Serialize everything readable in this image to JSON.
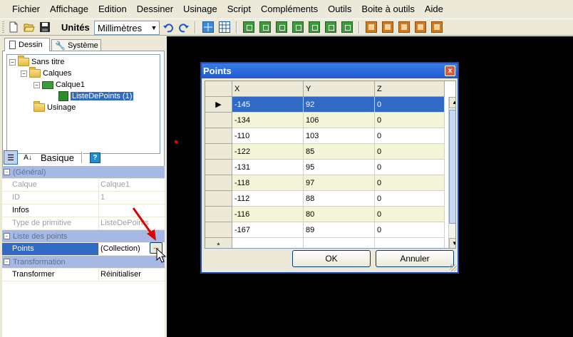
{
  "menu": [
    "Fichier",
    "Affichage",
    "Edition",
    "Dessiner",
    "Usinage",
    "Script",
    "Compléments",
    "Outils",
    "Boite à outils",
    "Aide"
  ],
  "toolbar": {
    "units_label": "Unités",
    "units_value": "Millimètres",
    "icons": [
      "new-file-icon",
      "open-folder-icon",
      "save-icon",
      "undo-icon",
      "redo-icon",
      "snap-grid-icon",
      "grid-icon",
      "draw-polyline-icon",
      "draw-circle-icon",
      "draw-points-icon",
      "draw-rectangle-icon",
      "draw-text-icon",
      "draw-shape-icon",
      "draw-3d-icon",
      "toolpath-1-icon",
      "toolpath-2-icon",
      "toolpath-3-icon",
      "toolpath-4-icon",
      "toolpath-5-icon"
    ]
  },
  "left_panel": {
    "tabs": [
      "Dessin",
      "Système"
    ],
    "tree": {
      "root": "Sans titre",
      "calques": "Calques",
      "calque1": "Calque1",
      "points_list": "ListeDePoints (1)",
      "usinage": "Usinage"
    },
    "prop_toolbar": {
      "basique": "Basique"
    },
    "properties": [
      {
        "type": "category",
        "label": "(Général)"
      },
      {
        "type": "prop",
        "name": "Calque",
        "value": "Calque1",
        "dim": true
      },
      {
        "type": "prop",
        "name": "ID",
        "value": "1",
        "dim": true
      },
      {
        "type": "prop",
        "name": "Infos",
        "value": "",
        "dim": false
      },
      {
        "type": "prop",
        "name": "Type de primitive",
        "value": "ListeDePoints",
        "dim": true
      },
      {
        "type": "category",
        "label": "Liste des points"
      },
      {
        "type": "prop",
        "name": "Points",
        "value": "(Collection)",
        "dim": false,
        "selected": true
      },
      {
        "type": "category",
        "label": "Transformation"
      },
      {
        "type": "prop",
        "name": "Transformer",
        "value": "Réinitialiser",
        "dim": false
      }
    ],
    "ellipsis": "..."
  },
  "dialog": {
    "title": "Points",
    "close": "x",
    "columns": [
      "X",
      "Y",
      "Z"
    ],
    "rows": [
      {
        "x": "-145",
        "y": "92",
        "z": "0"
      },
      {
        "x": "-134",
        "y": "106",
        "z": "0"
      },
      {
        "x": "-110",
        "y": "103",
        "z": "0"
      },
      {
        "x": "-122",
        "y": "85",
        "z": "0"
      },
      {
        "x": "-131",
        "y": "95",
        "z": "0"
      },
      {
        "x": "-118",
        "y": "97",
        "z": "0"
      },
      {
        "x": "-112",
        "y": "88",
        "z": "0"
      },
      {
        "x": "-116",
        "y": "80",
        "z": "0"
      },
      {
        "x": "-167",
        "y": "89",
        "z": "0"
      }
    ],
    "new_row_marker": "*",
    "ok": "OK",
    "cancel": "Annuler"
  }
}
